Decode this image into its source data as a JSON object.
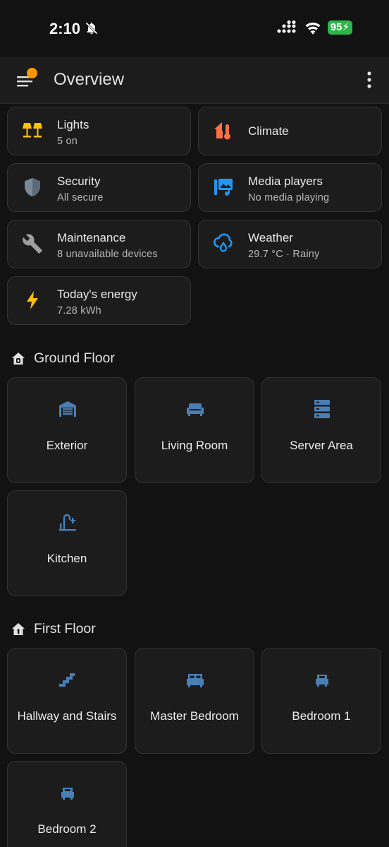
{
  "status_bar": {
    "time": "2:10",
    "battery": "95"
  },
  "app_bar": {
    "title": "Overview"
  },
  "summary": [
    {
      "title": "Lights",
      "subtitle": "5 on",
      "icon": "lamps-icon",
      "color": "#ffc107"
    },
    {
      "title": "Climate",
      "subtitle": "",
      "icon": "home-thermometer-icon",
      "color": "#ff7043"
    },
    {
      "title": "Security",
      "subtitle": "All secure",
      "icon": "shield-icon",
      "color": "#7b8a99"
    },
    {
      "title": "Media players",
      "subtitle": "No media playing",
      "icon": "media-player-icon",
      "color": "#2196f3"
    },
    {
      "title": "Maintenance",
      "subtitle": "8 unavailable devices",
      "icon": "wrench-icon",
      "color": "#9e9e9e"
    },
    {
      "title": "Weather",
      "subtitle": "29.7 °C · Rainy",
      "icon": "cloud-rain-icon",
      "color": "#2196f3"
    },
    {
      "title": "Today's energy",
      "subtitle": "7.28 kWh",
      "icon": "lightning-icon",
      "color": "#ffc107"
    }
  ],
  "floors": [
    {
      "name": "Ground Floor",
      "icon": "home-floor-0-icon",
      "areas": [
        {
          "name": "Exterior",
          "icon": "garage-icon"
        },
        {
          "name": "Living Room",
          "icon": "sofa-icon"
        },
        {
          "name": "Server Area",
          "icon": "server-icon"
        },
        {
          "name": "Kitchen",
          "icon": "faucet-icon"
        }
      ]
    },
    {
      "name": "First Floor",
      "icon": "home-floor-1-icon",
      "areas": [
        {
          "name": "Hallway and Stairs",
          "icon": "stairs-icon"
        },
        {
          "name": "Master Bedroom",
          "icon": "bed-double-icon"
        },
        {
          "name": "Bedroom 1",
          "icon": "bed-single-icon"
        },
        {
          "name": "Bedroom 2",
          "icon": "bed-single-icon"
        }
      ]
    }
  ],
  "area_icon_color": "#4a7fb5"
}
